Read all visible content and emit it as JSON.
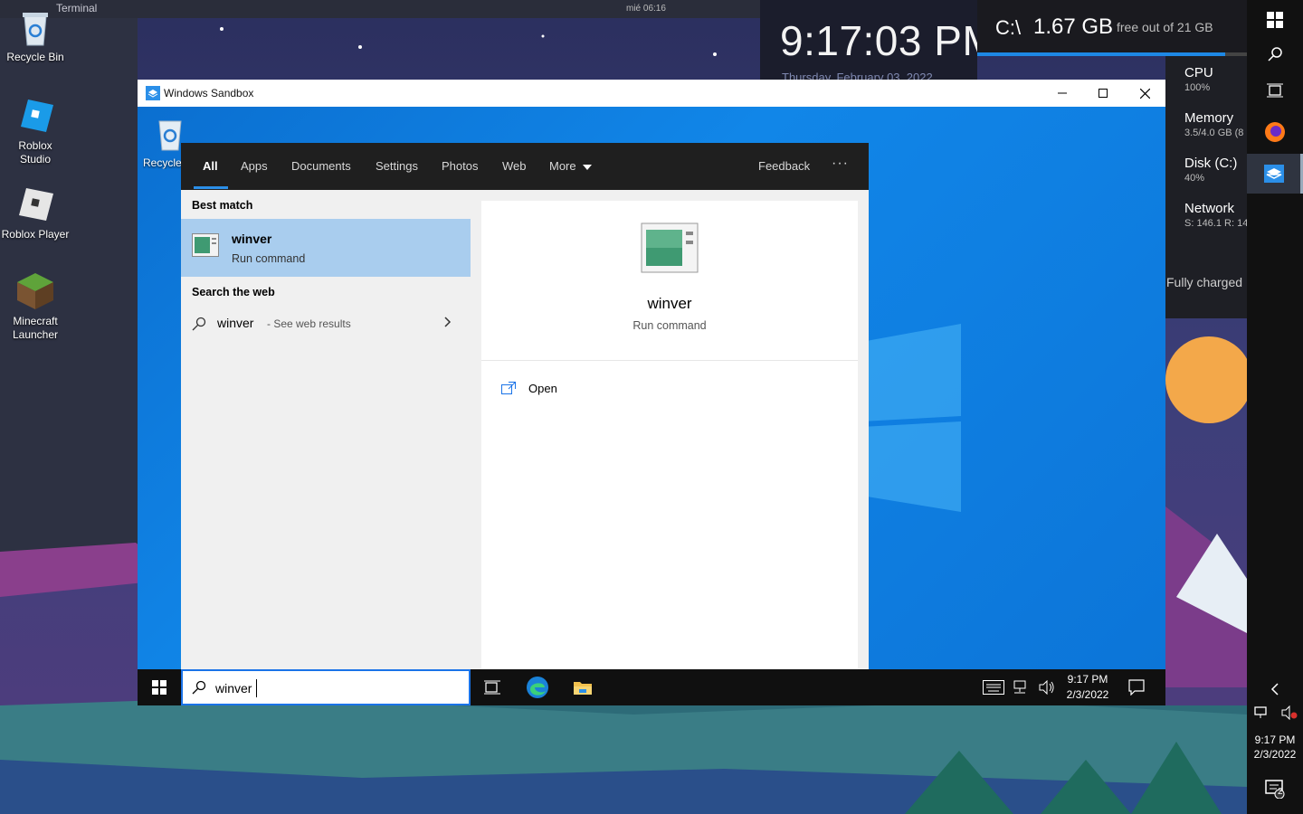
{
  "host": {
    "terminal": {
      "tab_label": "Terminal",
      "clock": "mié 06:16"
    },
    "desktop_icons": [
      {
        "label": "Recycle Bin"
      },
      {
        "label": "Roblox Studio"
      },
      {
        "label": "Roblox Player"
      },
      {
        "label": "Minecraft Launcher"
      }
    ],
    "clock_widget": {
      "time": "9:17:03 PM",
      "date": "Thursday, February 03, 2022"
    },
    "disk_widget": {
      "path": "C:\\",
      "size": "1.67 GB",
      "free_text": "free out of 21 GB",
      "used_fraction": 0.92
    },
    "perf": [
      {
        "title": "CPU",
        "value": "100%"
      },
      {
        "title": "Memory",
        "value": "3.5/4.0 GB (8"
      },
      {
        "title": "Disk (C:)",
        "value": "40%"
      },
      {
        "title": "Network",
        "value": "S: 146.1 R: 14"
      }
    ],
    "battery_text": "Fully charged",
    "tray": {
      "time": "9:17 PM",
      "date": "2/3/2022",
      "notification_count": "2"
    },
    "colors": {
      "accent": "#1e88e5",
      "taskbar": "#111111"
    }
  },
  "sandbox": {
    "title": "Windows Sandbox",
    "desktop_icon_label": "Recycle Bin",
    "search_panel": {
      "tabs": [
        "All",
        "Apps",
        "Documents",
        "Settings",
        "Photos",
        "Web",
        "More"
      ],
      "active_tab": "All",
      "feedback_label": "Feedback",
      "more_dots": "···",
      "best_match_header": "Best match",
      "best_match": {
        "name": "winver",
        "subtitle": "Run command"
      },
      "web_header": "Search the web",
      "web_result": {
        "query": "winver",
        "suffix": "- See web results"
      },
      "detail": {
        "name": "winver",
        "subtitle": "Run command",
        "action": "Open"
      }
    },
    "taskbar": {
      "search_value": "winver",
      "clock_time": "9:17 PM",
      "clock_date": "2/3/2022"
    },
    "colors": {
      "accent": "#0a74da",
      "highlight": "#a9cdee"
    }
  }
}
